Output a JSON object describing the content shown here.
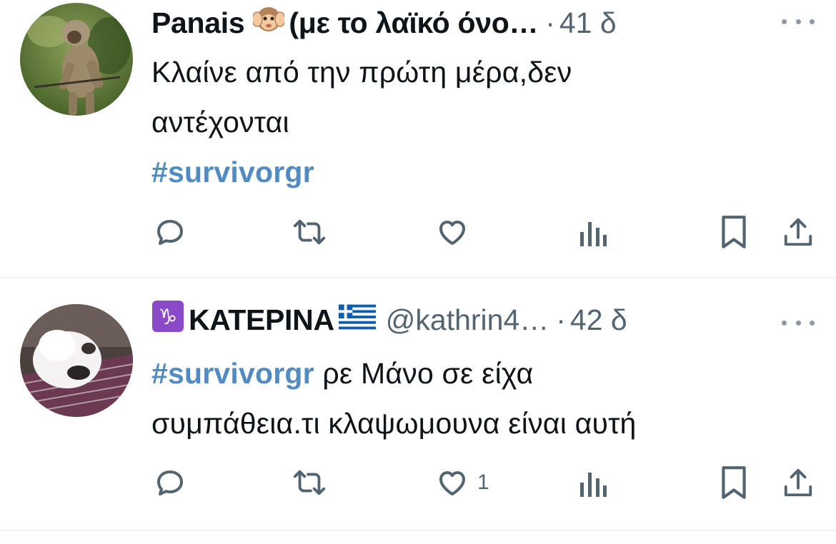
{
  "colors": {
    "accent": "#1d9bf0",
    "text": "#0f1419",
    "muted": "#536471",
    "divider": "#eff3f4"
  },
  "tweets": [
    {
      "display_name": "Panais",
      "name_emoji": "hear-no-evil-monkey-emoji",
      "name_suffix": "(με το λαϊκό όνο…",
      "separator": "·",
      "time": "41 δ",
      "text_lines": [
        "Κλαίνε από την πρώτη μέρα,δεν",
        "αντέχονται"
      ],
      "hashtag": "#survivorgr",
      "reply_count": "",
      "retweet_count": "",
      "like_count": "",
      "avatar": "monkey-photo"
    },
    {
      "name_prefix_emoji": "capricorn-emoji",
      "display_name": "ΚΑΤΕΡΙΝΑ",
      "name_flag": "greece-flag-emoji",
      "handle": "@kathrin4…",
      "separator": "·",
      "time": "42 δ",
      "hashtag": "#survivorgr",
      "text_after_hashtag": " ρε Μάνο σε είχα",
      "text_line2": "συμπάθεια.τι κλαψωμουνα είναι αυτή",
      "like_count": "1",
      "avatar": "white-rabbit-photo"
    }
  ],
  "icons": [
    "reply-icon",
    "retweet-icon",
    "like-icon",
    "views-icon",
    "bookmark-icon",
    "share-icon",
    "more-icon"
  ]
}
